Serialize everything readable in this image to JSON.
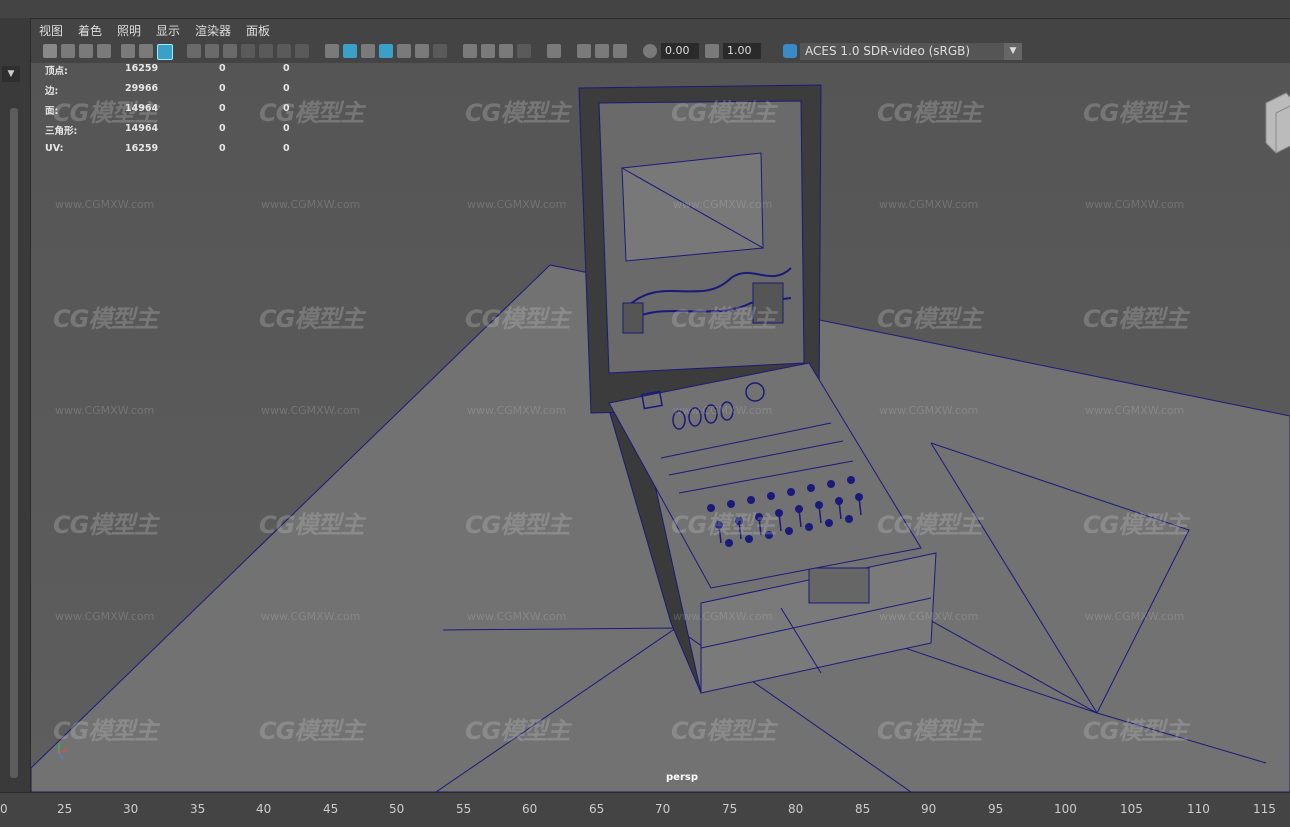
{
  "menus": [
    "视图",
    "着色",
    "照明",
    "显示",
    "渲染器",
    "面板"
  ],
  "toolbar": {
    "exposure": "0.00",
    "gamma": "1.00",
    "color_space": "ACES 1.0 SDR-video (sRGB)",
    "left_dropdown": "▼"
  },
  "hud": {
    "rows": [
      {
        "label": "顶点:",
        "a": "16259",
        "b": "0",
        "c": "0"
      },
      {
        "label": "边:",
        "a": "29966",
        "b": "0",
        "c": "0"
      },
      {
        "label": "面:",
        "a": "14964",
        "b": "0",
        "c": "0"
      },
      {
        "label": "三角形:",
        "a": "14964",
        "b": "0",
        "c": "0"
      },
      {
        "label": "UV:",
        "a": "16259",
        "b": "0",
        "c": "0"
      }
    ]
  },
  "camera_label": "persp",
  "ruler": {
    "first": "0",
    "ticks": [
      "25",
      "30",
      "35",
      "40",
      "45",
      "50",
      "55",
      "60",
      "65",
      "70",
      "75",
      "80",
      "85",
      "90",
      "95",
      "100",
      "105",
      "110",
      "115"
    ]
  },
  "watermark": {
    "logo": "CG模型主",
    "url": "www.CGMXW.com"
  },
  "colors": {
    "viewport_bg": "#595959",
    "wireframe": "#1a1a7a",
    "ground": "#707070",
    "ui_bg": "#444444"
  }
}
